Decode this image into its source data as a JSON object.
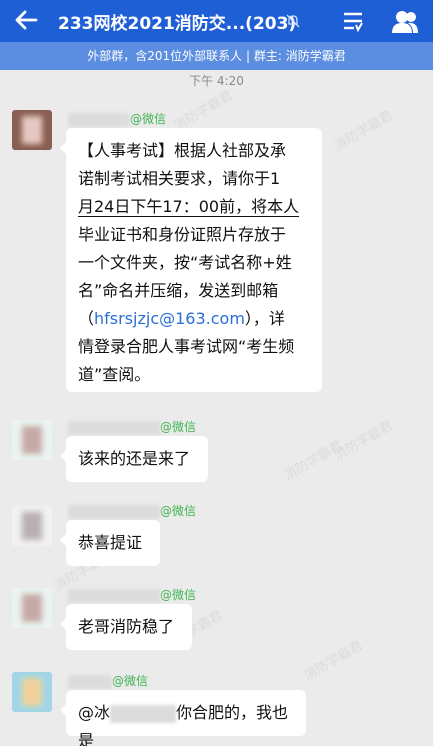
{
  "header": {
    "title": "233网校2021消防交...(203)",
    "subtitle": "外部群，含201位外部联系人 | 群主: 消防学霸君"
  },
  "chat": {
    "timestamp": "下午 4:20",
    "messages": [
      {
        "sender_suffix": "@微信",
        "lines": [
          "【人事考试】根据人社部及承",
          "诺制考试相关要求，请你于1",
          "月24日下午17：00前，将本人",
          "毕业证书和身份证照片存放于",
          "一个文件夹，按“考试名称+姓",
          "名”命名并压缩，发送到邮箱"
        ],
        "line7_prefix": "（",
        "email": "hfsrsjzjc@163.com",
        "line7_suffix": "），详",
        "line8": "情登录合肥人事考试网“考生频",
        "line9": "道”查阅。"
      },
      {
        "sender_suffix": "@微信",
        "text": "该来的还是来了"
      },
      {
        "sender_suffix": "@微信",
        "text": "恭喜提证"
      },
      {
        "sender_suffix": "@微信",
        "text": "老哥消防稳了"
      },
      {
        "sender_suffix": "@微信",
        "text_prefix": "@冰",
        "text_suffix": "你合肥的，我也是"
      }
    ]
  },
  "watermark": "消防学霸君",
  "icons": [
    "back-arrow-icon",
    "mute-icon",
    "menu-icon",
    "group-members-icon"
  ],
  "colors": {
    "header": "#1f5fd6",
    "subheader": "#5b8de0",
    "background": "#ebebeb",
    "wechat_green": "#3fb453",
    "link": "#2a6fd6"
  }
}
